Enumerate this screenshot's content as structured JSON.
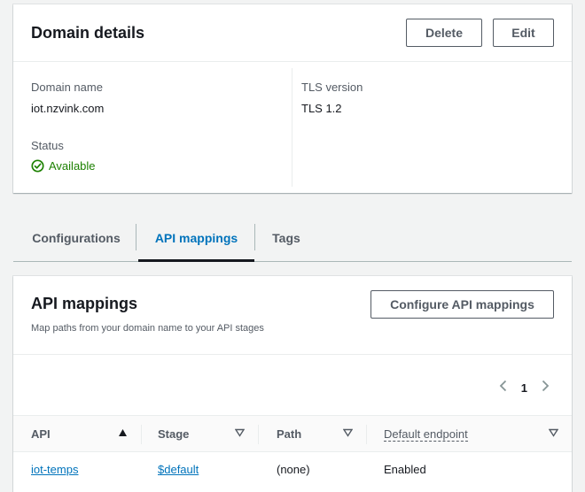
{
  "domain_details": {
    "title": "Domain details",
    "delete_label": "Delete",
    "edit_label": "Edit",
    "domain_name_label": "Domain name",
    "domain_name_value": "iot.nzvink.com",
    "status_label": "Status",
    "status_value": "Available",
    "tls_label": "TLS version",
    "tls_value": "TLS 1.2"
  },
  "tabs": [
    {
      "label": "Configurations"
    },
    {
      "label": "API mappings",
      "active": true
    },
    {
      "label": "Tags"
    }
  ],
  "api_mappings": {
    "title": "API mappings",
    "description": "Map paths from your domain name to your API stages",
    "configure_label": "Configure API mappings",
    "page": "1",
    "columns": [
      "API",
      "Stage",
      "Path",
      "Default endpoint"
    ],
    "rows": [
      {
        "api": "iot-temps",
        "stage": "$default",
        "path": "(none)",
        "default_endpoint": "Enabled"
      }
    ]
  },
  "colors": {
    "accent": "#0073bb",
    "success": "#1d8102",
    "text": "#16191f",
    "muted": "#545b64"
  }
}
